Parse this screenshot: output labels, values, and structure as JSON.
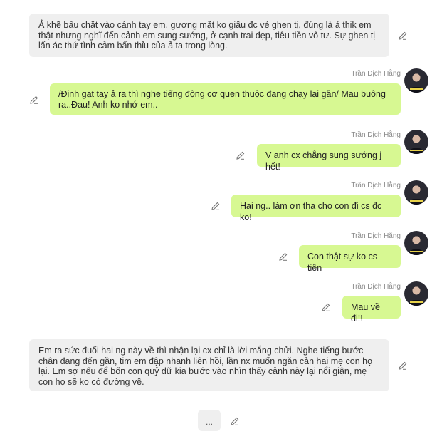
{
  "messages": [
    {
      "side": "left",
      "text": "Ả khẽ bấu chặt vào cánh tay em, gương mặt ko giấu đc vẻ ghen tị, đúng là ả thik em thật nhưng nghĩ đến cảnh em sung sướng, ở cạnh trai đẹp, tiêu tiền vô tư. Sự ghen tị lấn ác thứ tình cảm bẩn thỉu của ả ta trong lòng."
    },
    {
      "side": "right",
      "sender": "Trần Dịch Hằng",
      "text": "/Định gạt tay ả ra thì nghe tiếng động cơ quen thuộc đang chạy lại gần/ Mau buông ra..Đau! Anh ko nhớ em.."
    },
    {
      "side": "right",
      "sender": "Trần Dịch Hằng",
      "text": "V anh cx chẳng sung sướng j hết!"
    },
    {
      "side": "right",
      "sender": "Trần Dịch Hằng",
      "text": "Hai ng.. làm ơn tha cho con đi cs đc ko!"
    },
    {
      "side": "right",
      "sender": "Trần Dịch Hằng",
      "text": "Con thật sự ko cs tiền"
    },
    {
      "side": "right",
      "sender": "Trần Dịch Hằng",
      "text": "Mau về đi!!"
    },
    {
      "side": "left",
      "text": "Em ra sức đuổi hai ng này về thì nhận lại cx chỉ là lời mắng chửi. Nghe tiếng bước chân đang đến gần, tim em đập nhanh liên hồi, lần nx muốn ngăn cản hai mẹ con họ lại. Em sợ nếu để bốn con quỷ dữ kia bước vào nhìn thấy cảnh này lại nổi giận, mẹ con họ sẽ ko có đường về."
    }
  ],
  "typing_indicator": "...",
  "icons": {
    "edit": "pencil-icon",
    "avatar": "user-avatar"
  },
  "colors": {
    "left_bubble": "#efefef",
    "right_bubble": "#d7f892",
    "sender_name": "#8a8a8a"
  }
}
